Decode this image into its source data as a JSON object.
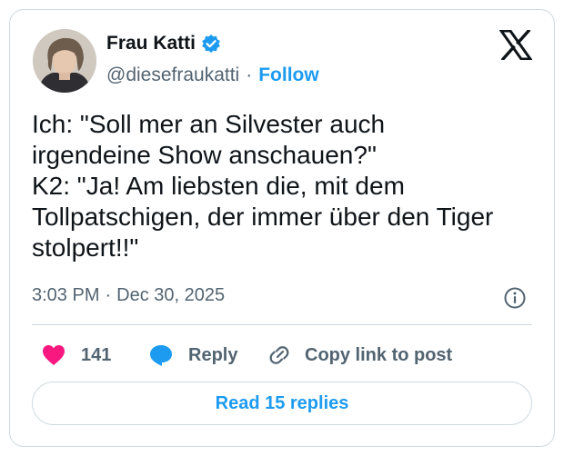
{
  "post": {
    "author": {
      "name": "Frau Katti",
      "handle": "@diesefraukatti",
      "follow_label": "Follow",
      "separator": "·"
    },
    "text": "Ich: \"Soll mer an Silvester auch\nirgendeine Show anschauen?\"\nK2: \"Ja! Am liebsten die, mit dem\nTollpatschigen, der immer über den Tiger\nstolpert!!\"",
    "time": "3:03 PM",
    "date_separator": "·",
    "date": "Dec 30, 2025",
    "likes": "141",
    "reply_label": "Reply",
    "copy_label": "Copy link to post",
    "read_replies_label": "Read 15 replies"
  },
  "icons": {
    "verified": "verified-badge-icon",
    "brand": "x-logo-icon",
    "info": "info-icon",
    "like": "heart-icon",
    "reply": "chat-bubble-icon",
    "copy": "link-icon"
  },
  "colors": {
    "accent": "#1d9bf0",
    "like": "#f91880",
    "text": "#0f1419",
    "muted": "#536471",
    "border": "#cfd9de"
  }
}
